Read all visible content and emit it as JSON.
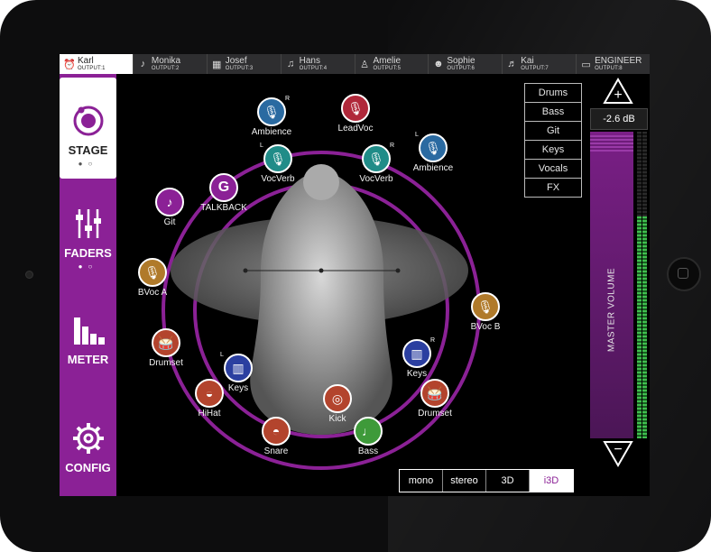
{
  "outputs": [
    {
      "name": "Karl",
      "output": "OUTPUT:1",
      "icon": "alarm-clock-icon",
      "glyph": "⏰",
      "active": true
    },
    {
      "name": "Monika",
      "output": "OUTPUT:2",
      "icon": "guitar-icon",
      "glyph": "♪"
    },
    {
      "name": "Josef",
      "output": "OUTPUT:3",
      "icon": "keyboard-icon",
      "glyph": "▦"
    },
    {
      "name": "Hans",
      "output": "OUTPUT:4",
      "icon": "guitar-icon",
      "glyph": "♫"
    },
    {
      "name": "Amelie",
      "output": "OUTPUT:5",
      "icon": "microphone-icon",
      "glyph": "♙"
    },
    {
      "name": "Sophie",
      "output": "OUTPUT:6",
      "icon": "group-icon",
      "glyph": "☻"
    },
    {
      "name": "Kai",
      "output": "OUTPUT:7",
      "icon": "saxophone-icon",
      "glyph": "♬"
    },
    {
      "name": "ENGINEER",
      "output": "OUTPUT:8",
      "icon": "mixer-icon",
      "glyph": "▭"
    }
  ],
  "sidebar": {
    "stage": "STAGE",
    "faders": "FADERS",
    "meter": "METER",
    "config": "CONFIG"
  },
  "channels": [
    {
      "label": "Ambience",
      "color": "#2a6aa1",
      "icon": "microphone-icon",
      "glyph": "🎙",
      "flag": "R"
    },
    {
      "label": "LeadVoc",
      "color": "#b0283a",
      "icon": "microphone-icon",
      "glyph": "🎙"
    },
    {
      "label": "Ambience",
      "color": "#2a6aa1",
      "icon": "microphone-icon",
      "glyph": "🎙",
      "flag": "L"
    },
    {
      "label": "VocVerb",
      "color": "#208c88",
      "icon": "microphone-icon",
      "glyph": "🎙",
      "flag": "L"
    },
    {
      "label": "VocVerb",
      "color": "#208c88",
      "icon": "microphone-icon",
      "glyph": "🎙",
      "flag": "R"
    },
    {
      "label": "TALKBACK",
      "color": "#8b2196",
      "icon": "talkback-icon",
      "glyph": "G"
    },
    {
      "label": "Git",
      "color": "#8b2196",
      "icon": "guitar-icon",
      "glyph": "♪"
    },
    {
      "label": "BVoc A",
      "color": "#b07a2a",
      "icon": "microphone-icon",
      "glyph": "🎙"
    },
    {
      "label": "BVoc B",
      "color": "#b07a2a",
      "icon": "microphone-icon",
      "glyph": "🎙"
    },
    {
      "label": "Drumset",
      "color": "#b3442d",
      "icon": "drum-icon",
      "glyph": "🥁"
    },
    {
      "label": "Keys",
      "color": "#2b3fa0",
      "icon": "keyboard-icon",
      "glyph": "▥",
      "flag": "L"
    },
    {
      "label": "Keys",
      "color": "#2b3fa0",
      "icon": "keyboard-icon",
      "glyph": "▥",
      "flag": "R"
    },
    {
      "label": "HiHat",
      "color": "#b3442d",
      "icon": "hihat-icon",
      "glyph": "◒"
    },
    {
      "label": "Kick",
      "color": "#b3442d",
      "icon": "kick-drum-icon",
      "glyph": "◎"
    },
    {
      "label": "Drumset",
      "color": "#b3442d",
      "icon": "drum-icon",
      "glyph": "🥁"
    },
    {
      "label": "Snare",
      "color": "#b3442d",
      "icon": "snare-icon",
      "glyph": "◓"
    },
    {
      "label": "Bass",
      "color": "#3e9a3a",
      "icon": "bass-guitar-icon",
      "glyph": "♩"
    }
  ],
  "groups": [
    "Drums",
    "Bass",
    "Git",
    "Keys",
    "Vocals",
    "FX"
  ],
  "master": {
    "volume": "-2.6 dB",
    "label": "MASTER VOLUME",
    "plus": "+",
    "minus": "−"
  },
  "modes": [
    {
      "label": "mono"
    },
    {
      "label": "stereo"
    },
    {
      "label": "3D"
    },
    {
      "label": "i3D",
      "active": true
    }
  ],
  "colors": {
    "accent": "#8b2196",
    "meter": "#3fbf4e"
  }
}
